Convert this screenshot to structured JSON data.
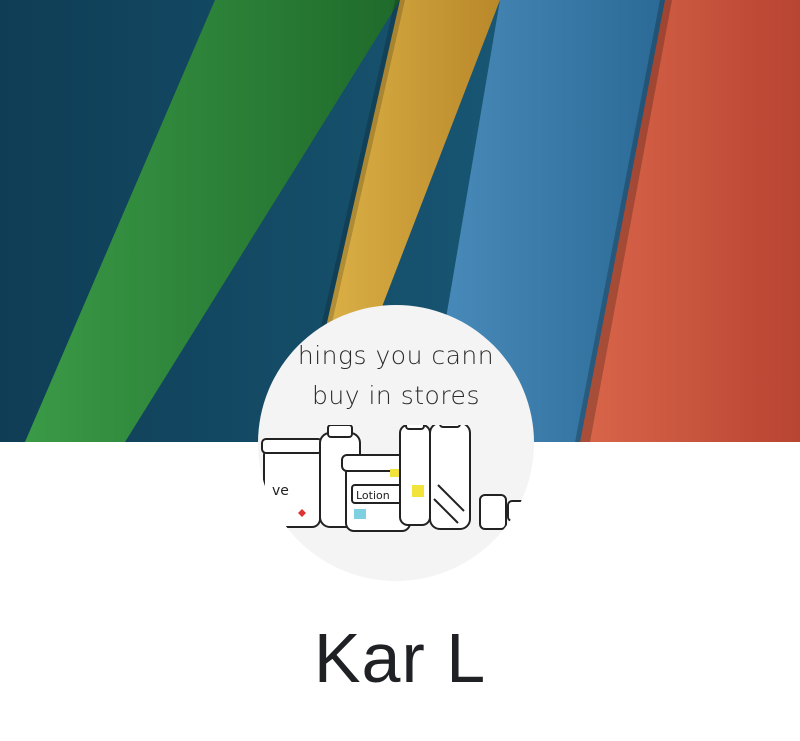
{
  "profile": {
    "cover_colors": [
      "#17506a",
      "#2f8a3a",
      "#d4a63a",
      "#3a7aa8",
      "#c8553c"
    ],
    "avatar": {
      "line1": "hings you cann",
      "line2": "buy in stores",
      "jar_label": "Lotion"
    },
    "name": "Kar L"
  }
}
